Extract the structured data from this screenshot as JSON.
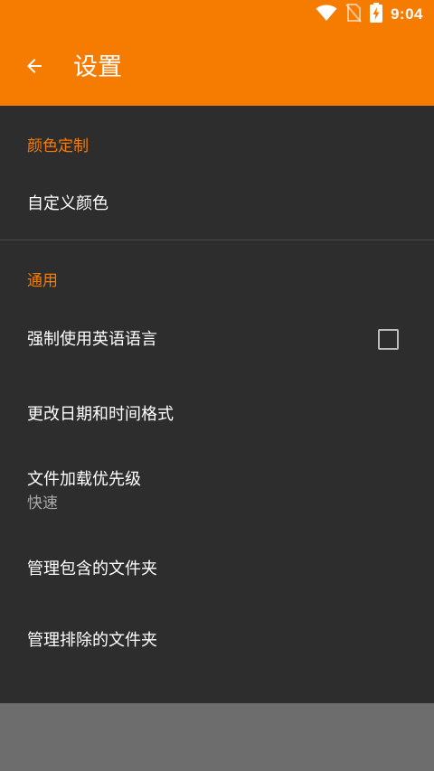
{
  "status_bar": {
    "time": "9:04",
    "icons": [
      "wifi-icon",
      "no-sim-icon",
      "battery-charging-icon"
    ]
  },
  "toolbar": {
    "back_icon": "arrow-back-icon",
    "title": "设置"
  },
  "colors": {
    "accent": "#f57c00",
    "background": "#2d2d2d",
    "bottom_panel": "#6d6d6d",
    "summary_text": "#a8a8a8"
  },
  "sections": [
    {
      "header": "颜色定制",
      "items": [
        {
          "title": "自定义颜色"
        }
      ]
    },
    {
      "header": "通用",
      "items": [
        {
          "title": "强制使用英语语言",
          "checkbox": false
        },
        {
          "title": "更改日期和时间格式"
        },
        {
          "title": "文件加载优先级",
          "summary": "快速"
        },
        {
          "title": "管理包含的文件夹"
        },
        {
          "title": "管理排除的文件夹"
        }
      ]
    }
  ]
}
